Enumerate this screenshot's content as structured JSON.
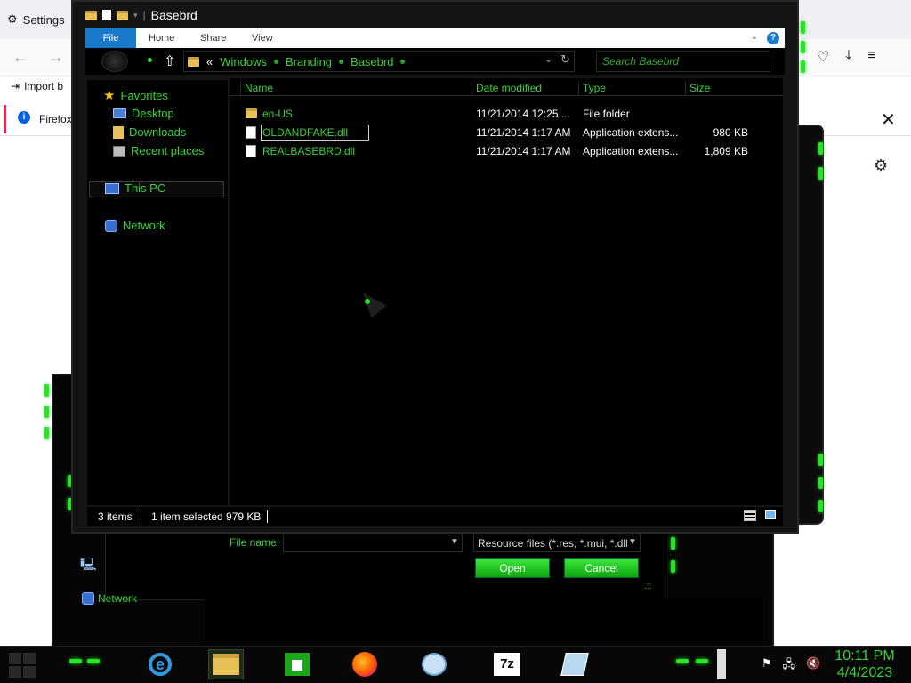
{
  "background": {
    "settings_label": "Settings",
    "import_label": "Import b",
    "firefox_label": "Firefox",
    "info_glyph": "i",
    "close_glyph": "✕",
    "gear_glyph": "⚙"
  },
  "window": {
    "title": "Basebrd"
  },
  "ribbon": {
    "tabs": [
      "File",
      "Home",
      "Share",
      "View"
    ],
    "help_glyph": "?"
  },
  "address": {
    "prefix": "«",
    "crumbs": [
      "Windows",
      "Branding",
      "Basebrd"
    ],
    "search_placeholder": "Search Basebrd"
  },
  "navpane": {
    "favorites": "Favorites",
    "desktop": "Desktop",
    "downloads": "Downloads",
    "recent": "Recent places",
    "thispc": "This PC",
    "network": "Network"
  },
  "columns": [
    "Name",
    "Date modified",
    "Type",
    "Size"
  ],
  "files": [
    {
      "name": "en-US",
      "date": "11/21/2014 12:25 ...",
      "type": "File folder",
      "size": "",
      "kind": "folder"
    },
    {
      "name": "OLDANDFAKE.dll",
      "date": "11/21/2014 1:17 AM",
      "type": "Application extens...",
      "size": "980 KB",
      "kind": "file"
    },
    {
      "name": "REALBASEBRD.dll",
      "date": "11/21/2014 1:17 AM",
      "type": "Application extens...",
      "size": "1,809 KB",
      "kind": "file"
    }
  ],
  "status": {
    "items": "3 items",
    "selected": "1 item selected  979 KB"
  },
  "save_area": {
    "file_name_label": "File name:",
    "file_type": "Resource files (*.res, *.mui, *.dll",
    "open_label": "Open",
    "cancel_label": "Cancel"
  },
  "back_dialog": {
    "network_label": "Network"
  },
  "taskbar": {
    "sevenzip_label": "7z",
    "ie_glyph": "e",
    "time": "10:11 PM",
    "date": "4/4/2023"
  }
}
